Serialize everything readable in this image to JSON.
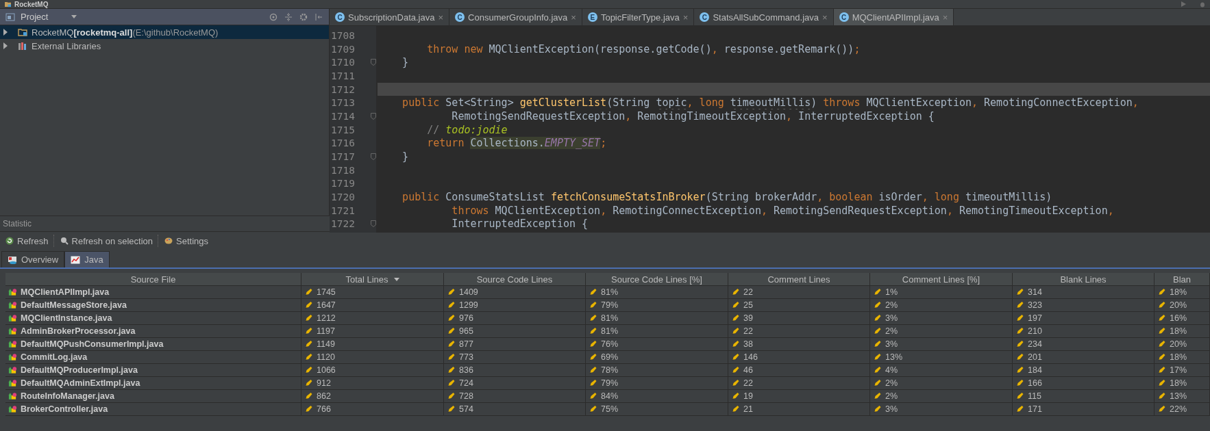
{
  "window": {
    "title": "RocketMQ"
  },
  "project_panel": {
    "title": "Project",
    "tree": [
      {
        "name": "RocketMQ",
        "module": "[rocketmq-all]",
        "path": "(E:\\github\\RocketMQ)",
        "kind": "module",
        "selected": true,
        "expanded": false
      },
      {
        "name": "External Libraries",
        "kind": "library",
        "selected": false,
        "expanded": false
      }
    ]
  },
  "editor_tabs": [
    {
      "icon_letter": "C",
      "label": "SubscriptionData.java",
      "close": "×",
      "selected": false
    },
    {
      "icon_letter": "C",
      "label": "ConsumerGroupInfo.java",
      "close": "×",
      "selected": false
    },
    {
      "icon_letter": "E",
      "label": "TopicFilterType.java",
      "close": "×",
      "selected": false
    },
    {
      "icon_letter": "C",
      "label": "StatsAllSubCommand.java",
      "close": "×",
      "selected": false
    },
    {
      "icon_letter": "C",
      "label": "MQClientAPIImpl.java",
      "close": "×",
      "selected": true
    }
  ],
  "code_lines": [
    {
      "number": "1708",
      "current": false,
      "fold": false
    },
    {
      "number": "1709",
      "current": false,
      "fold": false,
      "tokens": [
        {
          "kind": "keyword",
          "text": "        throw new"
        },
        {
          "kind": "plain",
          "text": " MQClientException(response.getCode()"
        },
        {
          "kind": "keyword",
          "text": ","
        },
        {
          "kind": "plain",
          "text": " response.getRemark())"
        },
        {
          "kind": "keyword",
          "text": ";"
        }
      ]
    },
    {
      "number": "1710",
      "current": false,
      "fold": true,
      "tokens": [
        {
          "kind": "plain",
          "text": "    }"
        }
      ]
    },
    {
      "number": "1711",
      "current": false,
      "fold": false
    },
    {
      "number": "1712",
      "current": true,
      "fold": false
    },
    {
      "number": "1713",
      "current": false,
      "fold": false,
      "tokens": [
        {
          "kind": "keyword",
          "text": "    public"
        },
        {
          "kind": "plain",
          "text": " Set<String> "
        },
        {
          "kind": "method",
          "text": "getClusterList"
        },
        {
          "kind": "plain",
          "text": "(String "
        },
        {
          "kind": "param",
          "text": "topic"
        },
        {
          "kind": "keyword",
          "text": ", long "
        },
        {
          "kind": "param",
          "text": "timeoutMillis"
        },
        {
          "kind": "plain",
          "text": ") "
        },
        {
          "kind": "keyword",
          "text": "throws"
        },
        {
          "kind": "plain",
          "text": " MQClientException"
        },
        {
          "kind": "keyword",
          "text": ","
        },
        {
          "kind": "plain",
          "text": " RemotingConnectException"
        },
        {
          "kind": "keyword",
          "text": ","
        }
      ]
    },
    {
      "number": "1714",
      "current": false,
      "fold": true,
      "tokens": [
        {
          "kind": "plain",
          "text": "            RemotingSendRequestException"
        },
        {
          "kind": "keyword",
          "text": ","
        },
        {
          "kind": "plain",
          "text": " RemotingTimeoutException"
        },
        {
          "kind": "keyword",
          "text": ","
        },
        {
          "kind": "plain",
          "text": " InterruptedException {"
        }
      ]
    },
    {
      "number": "1715",
      "current": false,
      "fold": false,
      "tokens": [
        {
          "kind": "comment",
          "text": "        // "
        },
        {
          "kind": "todo",
          "text": "todo:jodie"
        }
      ]
    },
    {
      "number": "1716",
      "current": false,
      "fold": false,
      "tokens": [
        {
          "kind": "keyword",
          "text": "        return "
        },
        {
          "kind": "highlight",
          "text": "Collections."
        },
        {
          "kind": "highlight-field",
          "text": "EMPTY_SET"
        },
        {
          "kind": "keyword",
          "text": ";"
        }
      ]
    },
    {
      "number": "1717",
      "current": false,
      "fold": true,
      "tokens": [
        {
          "kind": "plain",
          "text": "    }"
        }
      ]
    },
    {
      "number": "1718",
      "current": false,
      "fold": false
    },
    {
      "number": "1719",
      "current": false,
      "fold": false
    },
    {
      "number": "1720",
      "current": false,
      "fold": false,
      "tokens": [
        {
          "kind": "keyword",
          "text": "    public"
        },
        {
          "kind": "plain",
          "text": " ConsumeStatsList "
        },
        {
          "kind": "method",
          "text": "fetchConsumeStatsInBroker"
        },
        {
          "kind": "plain",
          "text": "(String brokerAddr"
        },
        {
          "kind": "keyword",
          "text": ", boolean"
        },
        {
          "kind": "plain",
          "text": " isOrder"
        },
        {
          "kind": "keyword",
          "text": ", long"
        },
        {
          "kind": "plain",
          "text": " timeoutMillis)"
        }
      ]
    },
    {
      "number": "1721",
      "current": false,
      "fold": false,
      "tokens": [
        {
          "kind": "keyword",
          "text": "            throws"
        },
        {
          "kind": "plain",
          "text": " MQClientException"
        },
        {
          "kind": "keyword",
          "text": ","
        },
        {
          "kind": "plain",
          "text": " RemotingConnectException"
        },
        {
          "kind": "keyword",
          "text": ","
        },
        {
          "kind": "plain",
          "text": " RemotingSendRequestException"
        },
        {
          "kind": "keyword",
          "text": ","
        },
        {
          "kind": "plain",
          "text": " RemotingTimeoutException"
        },
        {
          "kind": "keyword",
          "text": ","
        }
      ]
    },
    {
      "number": "1722",
      "current": false,
      "fold": true,
      "tokens": [
        {
          "kind": "plain",
          "text": "            InterruptedException {"
        }
      ]
    }
  ],
  "statistic": {
    "title": "Statistic",
    "toolbar": [
      {
        "kind": "refresh",
        "label": "Refresh"
      },
      {
        "kind": "refresh-selection",
        "label": "Refresh on selection"
      },
      {
        "kind": "settings",
        "label": "Settings"
      }
    ],
    "tabs": [
      {
        "kind": "overview",
        "label": "Overview",
        "selected": false
      },
      {
        "kind": "chart",
        "label": "Java",
        "selected": true
      }
    ],
    "table": {
      "columns": [
        {
          "label": "Source File",
          "sorted": false
        },
        {
          "label": "Total Lines",
          "sorted": true
        },
        {
          "label": "Source Code Lines",
          "sorted": false
        },
        {
          "label": "Source Code Lines [%]",
          "sorted": false
        },
        {
          "label": "Comment Lines",
          "sorted": false
        },
        {
          "label": "Comment Lines [%]",
          "sorted": false
        },
        {
          "label": "Blank Lines",
          "sorted": false
        },
        {
          "label": "Blan",
          "sorted": false
        }
      ],
      "rows": [
        [
          "MQClientAPIImpl.java",
          "1745",
          "1409",
          "81%",
          "22",
          "1%",
          "314",
          "18%"
        ],
        [
          "DefaultMessageStore.java",
          "1647",
          "1299",
          "79%",
          "25",
          "2%",
          "323",
          "20%"
        ],
        [
          "MQClientInstance.java",
          "1212",
          "976",
          "81%",
          "39",
          "3%",
          "197",
          "16%"
        ],
        [
          "AdminBrokerProcessor.java",
          "1197",
          "965",
          "81%",
          "22",
          "2%",
          "210",
          "18%"
        ],
        [
          "DefaultMQPushConsumerImpl.java",
          "1149",
          "877",
          "76%",
          "38",
          "3%",
          "234",
          "20%"
        ],
        [
          "CommitLog.java",
          "1120",
          "773",
          "69%",
          "146",
          "13%",
          "201",
          "18%"
        ],
        [
          "DefaultMQProducerImpl.java",
          "1066",
          "836",
          "78%",
          "46",
          "4%",
          "184",
          "17%"
        ],
        [
          "DefaultMQAdminExtImpl.java",
          "912",
          "724",
          "79%",
          "22",
          "2%",
          "166",
          "18%"
        ],
        [
          "RouteInfoManager.java",
          "862",
          "728",
          "84%",
          "19",
          "2%",
          "115",
          "13%"
        ],
        [
          "BrokerController.java",
          "766",
          "574",
          "75%",
          "21",
          "3%",
          "171",
          "22%"
        ]
      ]
    }
  }
}
